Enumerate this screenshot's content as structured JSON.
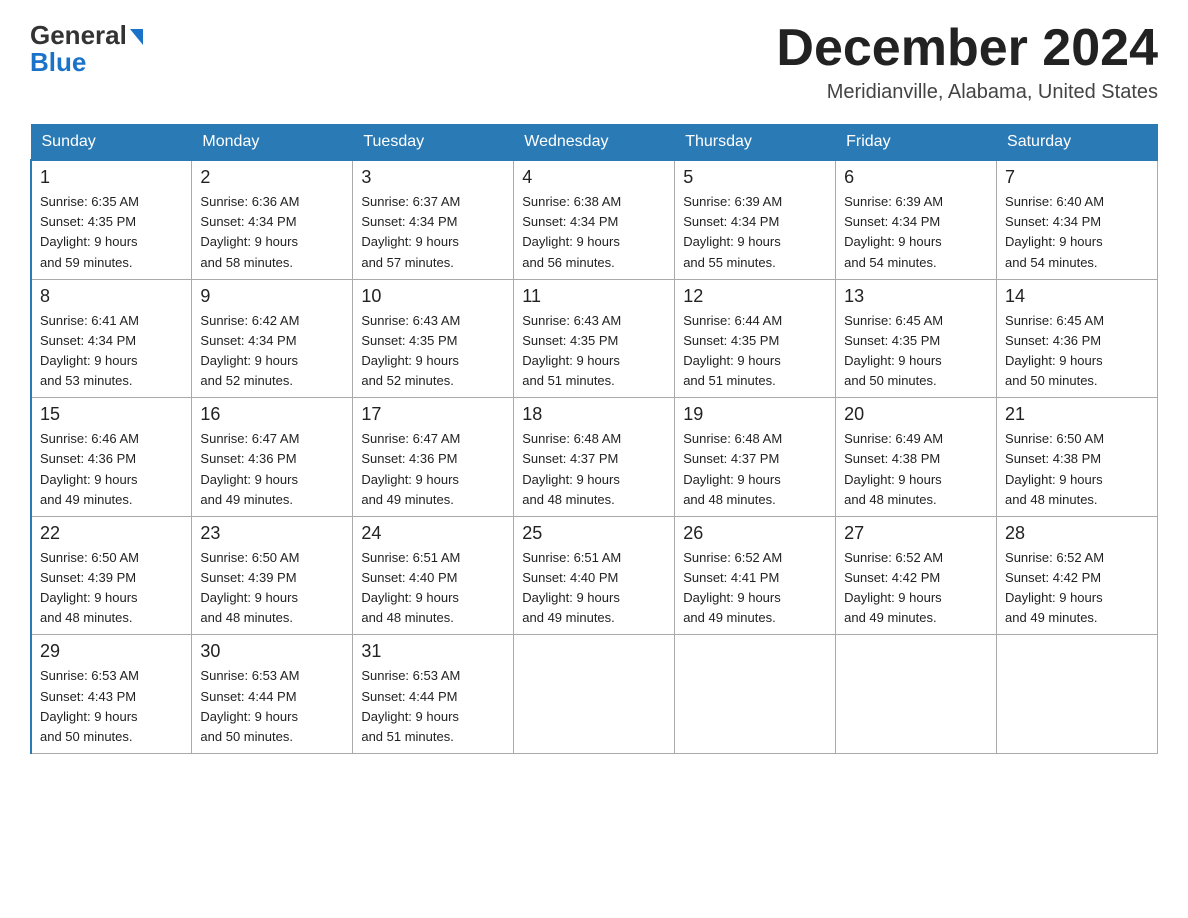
{
  "header": {
    "logo_general": "General",
    "logo_blue": "Blue",
    "month_title": "December 2024",
    "location": "Meridianville, Alabama, United States"
  },
  "days_of_week": [
    "Sunday",
    "Monday",
    "Tuesday",
    "Wednesday",
    "Thursday",
    "Friday",
    "Saturday"
  ],
  "weeks": [
    [
      {
        "day": "1",
        "sunrise": "6:35 AM",
        "sunset": "4:35 PM",
        "daylight": "9 hours and 59 minutes."
      },
      {
        "day": "2",
        "sunrise": "6:36 AM",
        "sunset": "4:34 PM",
        "daylight": "9 hours and 58 minutes."
      },
      {
        "day": "3",
        "sunrise": "6:37 AM",
        "sunset": "4:34 PM",
        "daylight": "9 hours and 57 minutes."
      },
      {
        "day": "4",
        "sunrise": "6:38 AM",
        "sunset": "4:34 PM",
        "daylight": "9 hours and 56 minutes."
      },
      {
        "day": "5",
        "sunrise": "6:39 AM",
        "sunset": "4:34 PM",
        "daylight": "9 hours and 55 minutes."
      },
      {
        "day": "6",
        "sunrise": "6:39 AM",
        "sunset": "4:34 PM",
        "daylight": "9 hours and 54 minutes."
      },
      {
        "day": "7",
        "sunrise": "6:40 AM",
        "sunset": "4:34 PM",
        "daylight": "9 hours and 54 minutes."
      }
    ],
    [
      {
        "day": "8",
        "sunrise": "6:41 AM",
        "sunset": "4:34 PM",
        "daylight": "9 hours and 53 minutes."
      },
      {
        "day": "9",
        "sunrise": "6:42 AM",
        "sunset": "4:34 PM",
        "daylight": "9 hours and 52 minutes."
      },
      {
        "day": "10",
        "sunrise": "6:43 AM",
        "sunset": "4:35 PM",
        "daylight": "9 hours and 52 minutes."
      },
      {
        "day": "11",
        "sunrise": "6:43 AM",
        "sunset": "4:35 PM",
        "daylight": "9 hours and 51 minutes."
      },
      {
        "day": "12",
        "sunrise": "6:44 AM",
        "sunset": "4:35 PM",
        "daylight": "9 hours and 51 minutes."
      },
      {
        "day": "13",
        "sunrise": "6:45 AM",
        "sunset": "4:35 PM",
        "daylight": "9 hours and 50 minutes."
      },
      {
        "day": "14",
        "sunrise": "6:45 AM",
        "sunset": "4:36 PM",
        "daylight": "9 hours and 50 minutes."
      }
    ],
    [
      {
        "day": "15",
        "sunrise": "6:46 AM",
        "sunset": "4:36 PM",
        "daylight": "9 hours and 49 minutes."
      },
      {
        "day": "16",
        "sunrise": "6:47 AM",
        "sunset": "4:36 PM",
        "daylight": "9 hours and 49 minutes."
      },
      {
        "day": "17",
        "sunrise": "6:47 AM",
        "sunset": "4:36 PM",
        "daylight": "9 hours and 49 minutes."
      },
      {
        "day": "18",
        "sunrise": "6:48 AM",
        "sunset": "4:37 PM",
        "daylight": "9 hours and 48 minutes."
      },
      {
        "day": "19",
        "sunrise": "6:48 AM",
        "sunset": "4:37 PM",
        "daylight": "9 hours and 48 minutes."
      },
      {
        "day": "20",
        "sunrise": "6:49 AM",
        "sunset": "4:38 PM",
        "daylight": "9 hours and 48 minutes."
      },
      {
        "day": "21",
        "sunrise": "6:50 AM",
        "sunset": "4:38 PM",
        "daylight": "9 hours and 48 minutes."
      }
    ],
    [
      {
        "day": "22",
        "sunrise": "6:50 AM",
        "sunset": "4:39 PM",
        "daylight": "9 hours and 48 minutes."
      },
      {
        "day": "23",
        "sunrise": "6:50 AM",
        "sunset": "4:39 PM",
        "daylight": "9 hours and 48 minutes."
      },
      {
        "day": "24",
        "sunrise": "6:51 AM",
        "sunset": "4:40 PM",
        "daylight": "9 hours and 48 minutes."
      },
      {
        "day": "25",
        "sunrise": "6:51 AM",
        "sunset": "4:40 PM",
        "daylight": "9 hours and 49 minutes."
      },
      {
        "day": "26",
        "sunrise": "6:52 AM",
        "sunset": "4:41 PM",
        "daylight": "9 hours and 49 minutes."
      },
      {
        "day": "27",
        "sunrise": "6:52 AM",
        "sunset": "4:42 PM",
        "daylight": "9 hours and 49 minutes."
      },
      {
        "day": "28",
        "sunrise": "6:52 AM",
        "sunset": "4:42 PM",
        "daylight": "9 hours and 49 minutes."
      }
    ],
    [
      {
        "day": "29",
        "sunrise": "6:53 AM",
        "sunset": "4:43 PM",
        "daylight": "9 hours and 50 minutes."
      },
      {
        "day": "30",
        "sunrise": "6:53 AM",
        "sunset": "4:44 PM",
        "daylight": "9 hours and 50 minutes."
      },
      {
        "day": "31",
        "sunrise": "6:53 AM",
        "sunset": "4:44 PM",
        "daylight": "9 hours and 51 minutes."
      },
      null,
      null,
      null,
      null
    ]
  ],
  "labels": {
    "sunrise": "Sunrise:",
    "sunset": "Sunset:",
    "daylight": "Daylight:"
  }
}
